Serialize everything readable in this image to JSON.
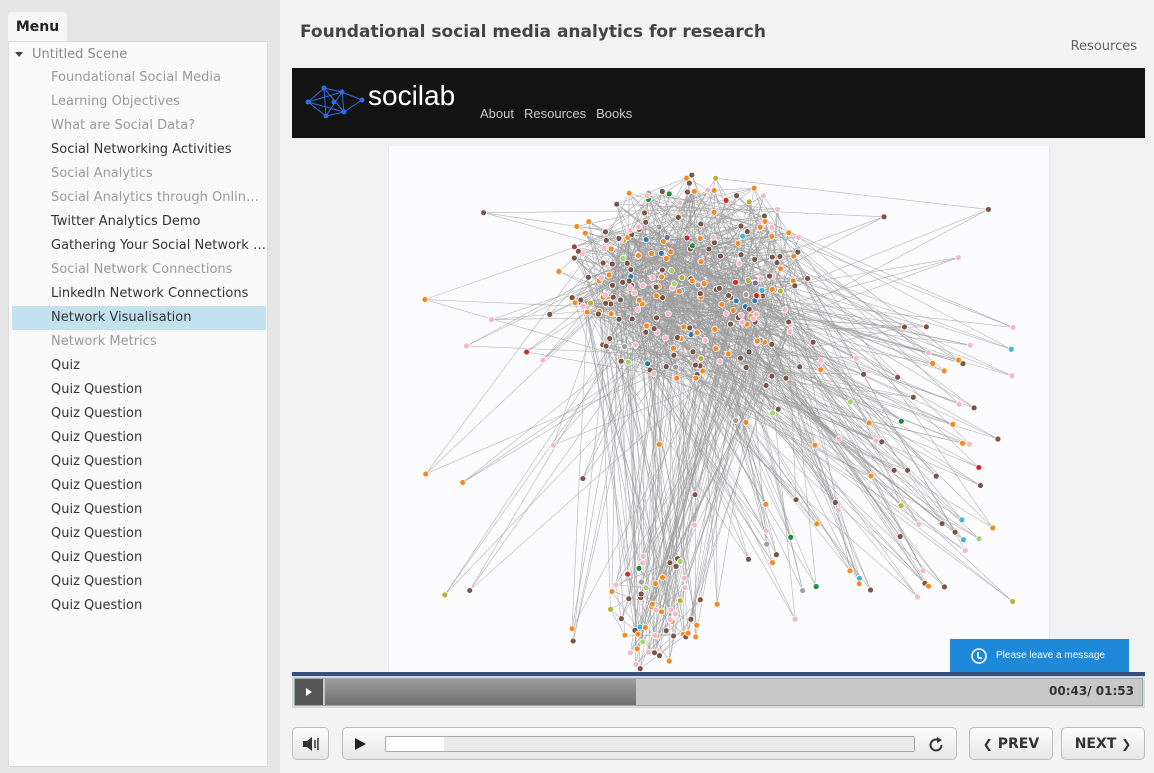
{
  "menu": {
    "tab_label": "Menu",
    "scene": "Untitled Scene",
    "items": [
      {
        "label": "Foundational Social Media",
        "state": "dim"
      },
      {
        "label": "Learning Objectives",
        "state": "dim"
      },
      {
        "label": "What are Social Data?",
        "state": "dim"
      },
      {
        "label": "Social Networking Activities",
        "state": "normal"
      },
      {
        "label": "Social Analytics",
        "state": "dim"
      },
      {
        "label": "Social Analytics through Online T...",
        "state": "dim"
      },
      {
        "label": "Twitter Analytics Demo",
        "state": "normal"
      },
      {
        "label": "Gathering Your Social Network D...",
        "state": "normal"
      },
      {
        "label": "Social Network Connections",
        "state": "dim"
      },
      {
        "label": "LinkedIn Network Connections",
        "state": "normal"
      },
      {
        "label": "Network Visualisation",
        "state": "active"
      },
      {
        "label": "Network Metrics",
        "state": "dim"
      },
      {
        "label": "Quiz",
        "state": "normal"
      },
      {
        "label": "Quiz Question",
        "state": "normal"
      },
      {
        "label": "Quiz Question",
        "state": "normal"
      },
      {
        "label": "Quiz Question",
        "state": "normal"
      },
      {
        "label": "Quiz Question",
        "state": "normal"
      },
      {
        "label": "Quiz Question",
        "state": "normal"
      },
      {
        "label": "Quiz Question",
        "state": "normal"
      },
      {
        "label": "Quiz Question",
        "state": "normal"
      },
      {
        "label": "Quiz Question",
        "state": "normal"
      },
      {
        "label": "Quiz Question",
        "state": "normal"
      },
      {
        "label": "Quiz Question",
        "state": "normal"
      }
    ]
  },
  "header": {
    "title": "Foundational social media analytics for research",
    "resources": "Resources"
  },
  "video": {
    "brand": "socilab",
    "nav": [
      "About",
      "Resources",
      "Books"
    ],
    "chat_label": "Please leave a message",
    "elapsed_time": "00:43",
    "total_time": "01:53",
    "time_display": "00:43/ 01:53",
    "seek_progress": 0.38
  },
  "controls": {
    "prev_label": "PREV",
    "next_label": "NEXT",
    "slide_progress": 0.11
  },
  "colors": {
    "menu_active": "#c3e2f0",
    "chat_button": "#1e88d9",
    "site_header": "#131313",
    "seek_border": "#3a4e7a"
  },
  "node_palette": [
    "#7a5548",
    "#f28b24",
    "#f4b8c8",
    "#9e9e9e",
    "#2c7bb6",
    "#1f8f3a",
    "#d62728",
    "#a5d36e",
    "#7b68b0",
    "#b8b23a",
    "#3fb6d8"
  ]
}
